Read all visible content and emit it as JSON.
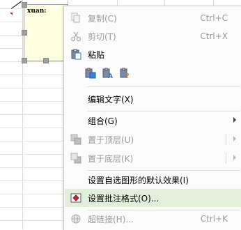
{
  "comment": {
    "text": "xuan:"
  },
  "menu": {
    "items": [
      {
        "label": "复制(C)",
        "shortcut": "Ctrl+C",
        "icon": "copy-icon",
        "disabled": true
      },
      {
        "label": "剪切(T)",
        "shortcut": "Ctrl+X",
        "icon": "cut-icon",
        "disabled": true
      },
      {
        "label": "粘贴",
        "shortcut": "",
        "icon": "paste-icon",
        "disabled": false
      },
      {
        "label": "编辑文字(X)",
        "shortcut": "",
        "icon": "",
        "disabled": false
      },
      {
        "label": "组合(G)",
        "shortcut": "",
        "icon": "",
        "disabled": false,
        "submenu": true
      },
      {
        "label": "置于顶层(U)",
        "shortcut": "",
        "icon": "bring-to-front-icon",
        "disabled": true,
        "submenu": true
      },
      {
        "label": "置于底层(K)",
        "shortcut": "",
        "icon": "send-to-back-icon",
        "disabled": true,
        "submenu": true
      },
      {
        "label": "设置自选图形的默认效果(I)",
        "shortcut": "",
        "icon": "",
        "disabled": false
      },
      {
        "label": "设置批注格式(O)...",
        "shortcut": "",
        "icon": "format-comment-icon",
        "disabled": false,
        "highlighted": true
      },
      {
        "label": "超链接(H)...",
        "shortcut": "Ctrl+K",
        "icon": "hyperlink-icon",
        "disabled": true
      }
    ],
    "paste_options": [
      "paste-keep-format-icon",
      "paste-text-only-icon",
      "paste-special-icon"
    ]
  }
}
